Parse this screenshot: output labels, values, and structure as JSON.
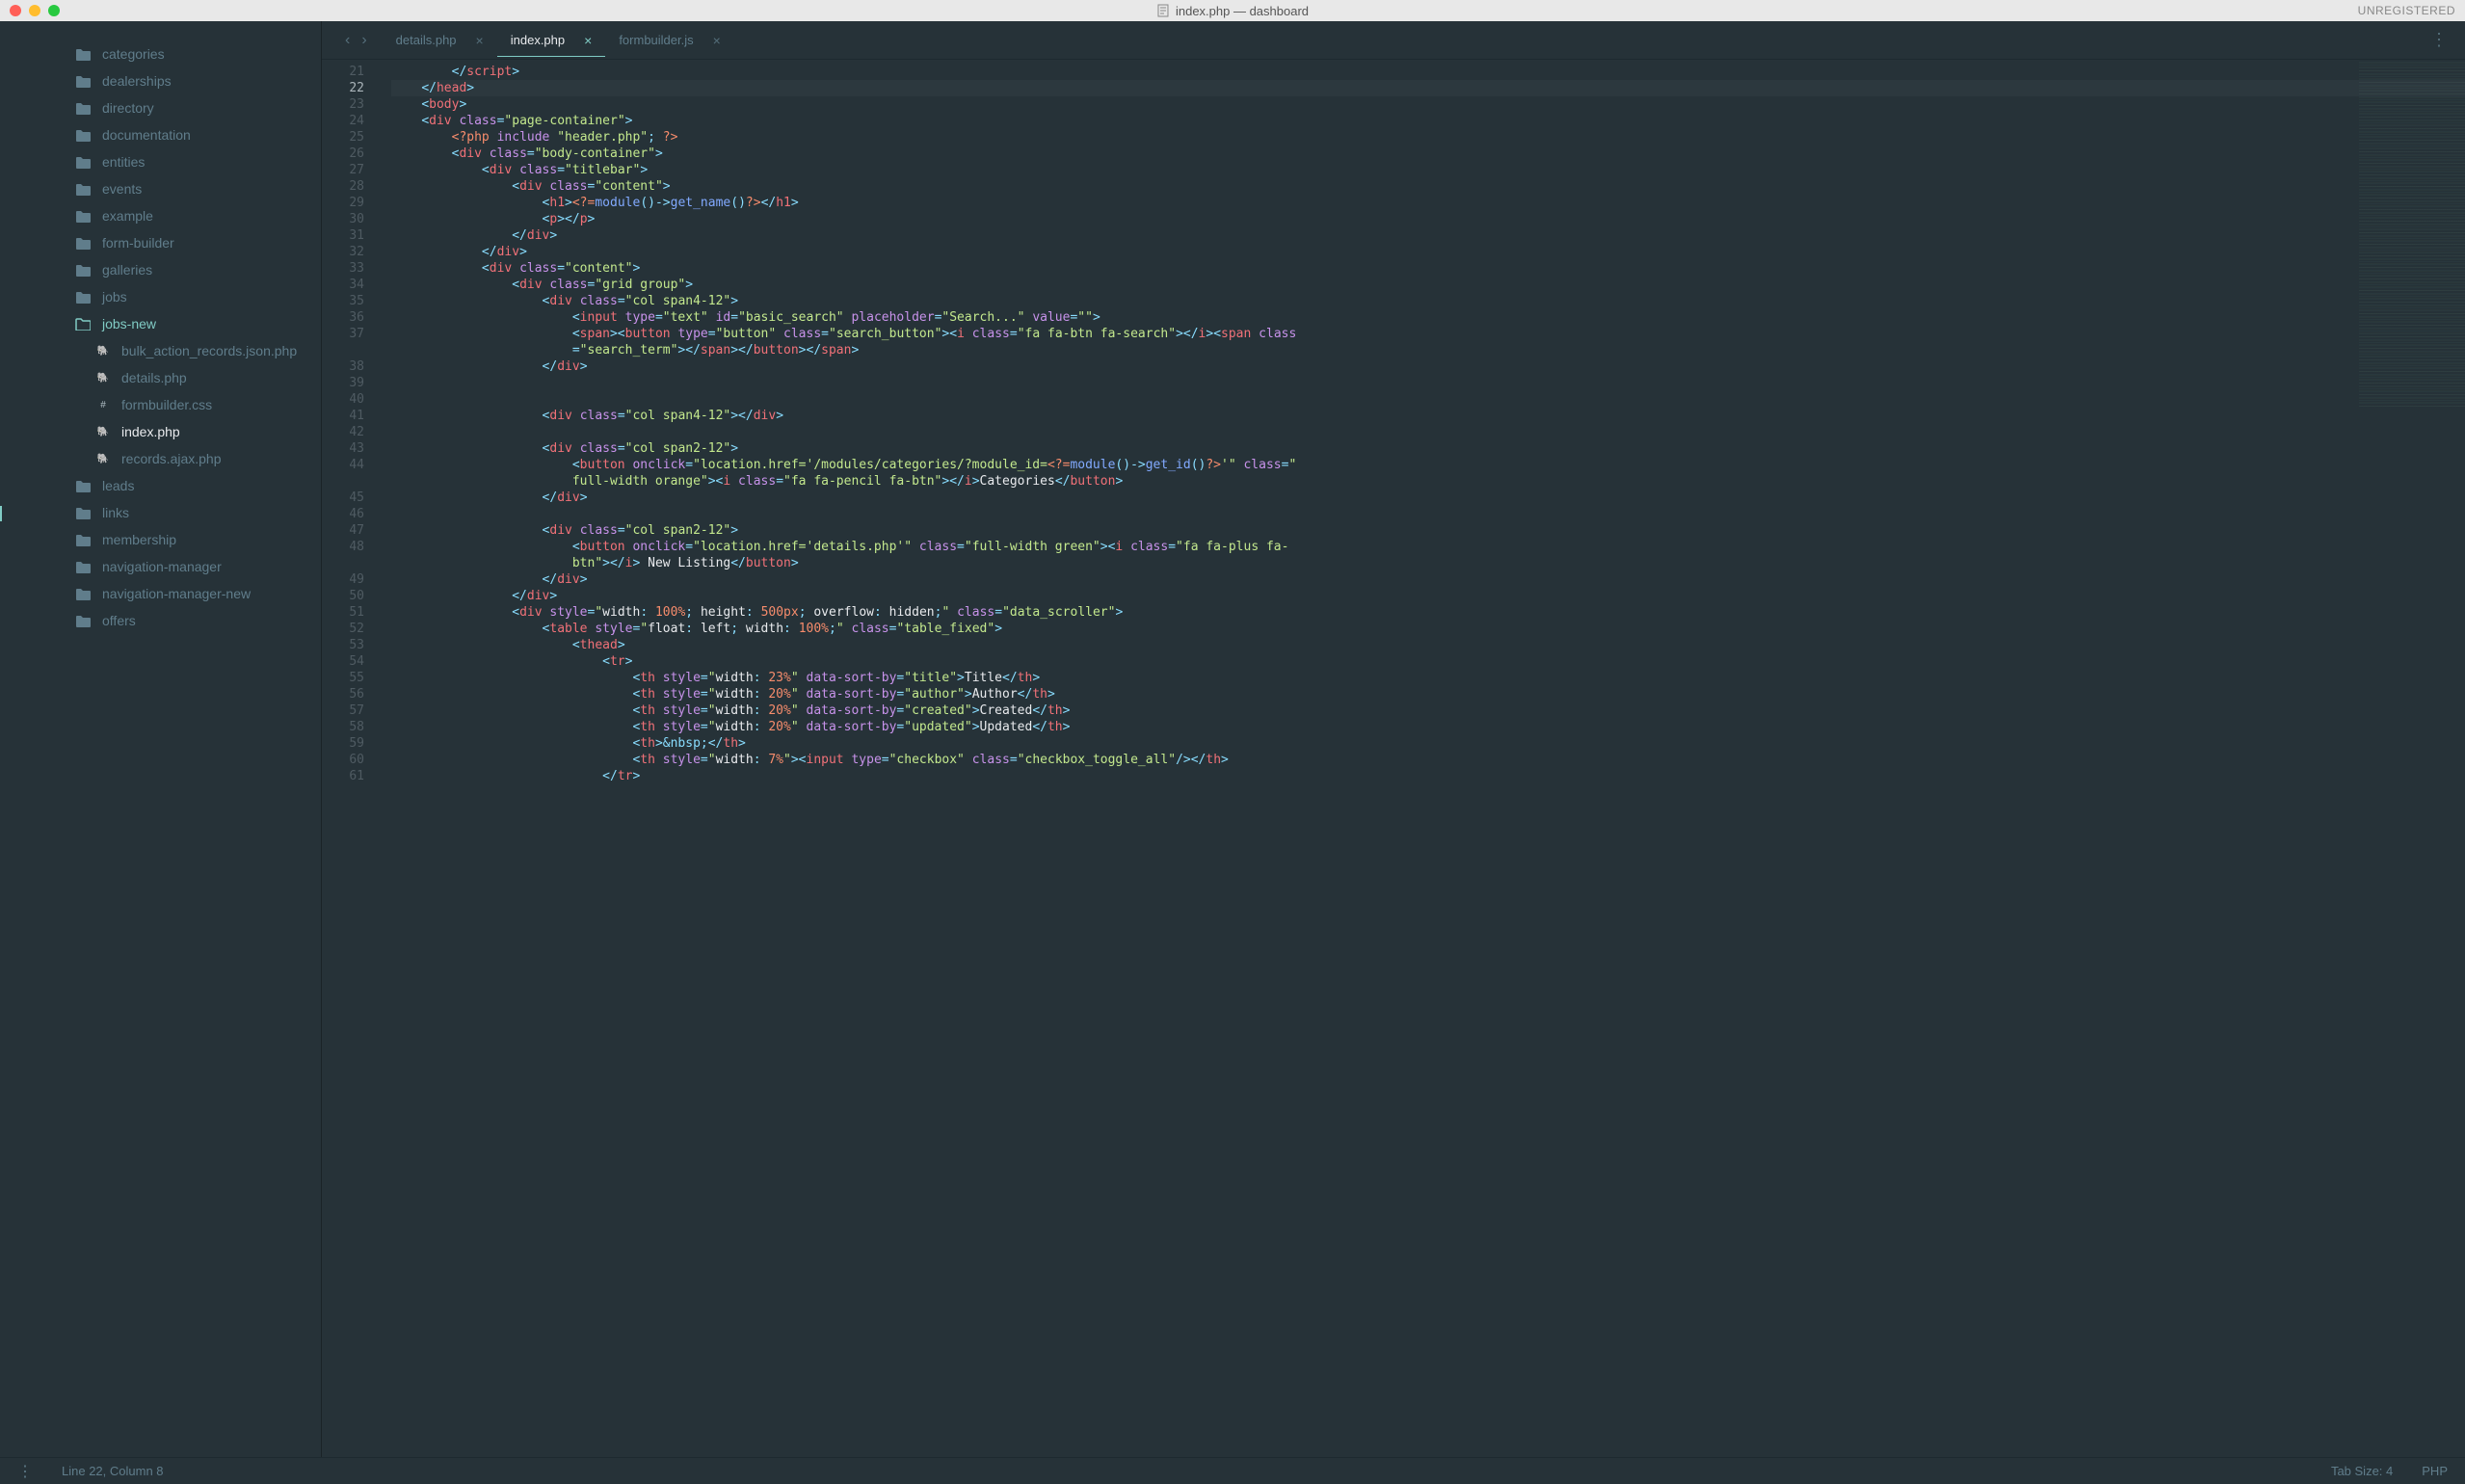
{
  "window": {
    "title": "index.php — dashboard",
    "unregistered": "UNREGISTERED"
  },
  "sidebar": {
    "items": [
      {
        "type": "folder",
        "label": "categories"
      },
      {
        "type": "folder",
        "label": "dealerships"
      },
      {
        "type": "folder",
        "label": "directory"
      },
      {
        "type": "folder",
        "label": "documentation"
      },
      {
        "type": "folder",
        "label": "entities"
      },
      {
        "type": "folder",
        "label": "events"
      },
      {
        "type": "folder",
        "label": "example"
      },
      {
        "type": "folder",
        "label": "form-builder"
      },
      {
        "type": "folder",
        "label": "galleries"
      },
      {
        "type": "folder",
        "label": "jobs"
      },
      {
        "type": "folder-open",
        "label": "jobs-new"
      },
      {
        "type": "php",
        "label": "bulk_action_records.json.php",
        "indent": true
      },
      {
        "type": "php",
        "label": "details.php",
        "indent": true
      },
      {
        "type": "css",
        "label": "formbuilder.css",
        "indent": true
      },
      {
        "type": "php",
        "label": "index.php",
        "indent": true,
        "active": true
      },
      {
        "type": "php",
        "label": "records.ajax.php",
        "indent": true
      },
      {
        "type": "folder",
        "label": "leads"
      },
      {
        "type": "folder",
        "label": "links"
      },
      {
        "type": "folder",
        "label": "membership"
      },
      {
        "type": "folder",
        "label": "navigation-manager"
      },
      {
        "type": "folder",
        "label": "navigation-manager-new"
      },
      {
        "type": "folder",
        "label": "offers"
      }
    ]
  },
  "tabs": [
    {
      "label": "details.php",
      "active": false
    },
    {
      "label": "index.php",
      "active": true
    },
    {
      "label": "formbuilder.js",
      "active": false
    }
  ],
  "gutter": {
    "start": 21,
    "end": 61,
    "highlight": 22
  },
  "code_lines": [
    {
      "n": 21,
      "html": "        <span class='t-punc'>&lt;/</span><span class='t-tag'>script</span><span class='t-punc'>&gt;</span>"
    },
    {
      "n": 22,
      "hl": true,
      "html": "    <span class='t-punc'>&lt;/</span><span class='t-tag'>head</span><span class='t-punc'>&gt;</span>"
    },
    {
      "n": 23,
      "html": "    <span class='t-punc'>&lt;</span><span class='t-tag'>body</span><span class='t-punc'>&gt;</span>"
    },
    {
      "n": 24,
      "html": "    <span class='t-punc'>&lt;</span><span class='t-tag'>div</span> <span class='t-attr'>class</span><span class='t-op'>=</span><span class='t-str'>\"page-container\"</span><span class='t-punc'>&gt;</span>"
    },
    {
      "n": 25,
      "html": "        <span class='t-php'>&lt;?php</span> <span class='t-kw'>include</span> <span class='t-str'>\"header.php\"</span><span class='t-punc'>;</span> <span class='t-php'>?&gt;</span>"
    },
    {
      "n": 26,
      "html": "        <span class='t-punc'>&lt;</span><span class='t-tag'>div</span> <span class='t-attr'>class</span><span class='t-op'>=</span><span class='t-str'>\"body-container\"</span><span class='t-punc'>&gt;</span>"
    },
    {
      "n": 27,
      "html": "            <span class='t-punc'>&lt;</span><span class='t-tag'>div</span> <span class='t-attr'>class</span><span class='t-op'>=</span><span class='t-str'>\"titlebar\"</span><span class='t-punc'>&gt;</span>"
    },
    {
      "n": 28,
      "html": "                <span class='t-punc'>&lt;</span><span class='t-tag'>div</span> <span class='t-attr'>class</span><span class='t-op'>=</span><span class='t-str'>\"content\"</span><span class='t-punc'>&gt;</span>"
    },
    {
      "n": 29,
      "html": "                    <span class='t-punc'>&lt;</span><span class='t-tag'>h1</span><span class='t-punc'>&gt;</span><span class='t-php'>&lt;?=</span><span class='t-fn'>module</span><span class='t-punc'>()</span><span class='t-op'>-&gt;</span><span class='t-fn'>get_name</span><span class='t-punc'>()</span><span class='t-php'>?&gt;</span><span class='t-punc'>&lt;/</span><span class='t-tag'>h1</span><span class='t-punc'>&gt;</span>"
    },
    {
      "n": 30,
      "html": "                    <span class='t-punc'>&lt;</span><span class='t-tag'>p</span><span class='t-punc'>&gt;&lt;/</span><span class='t-tag'>p</span><span class='t-punc'>&gt;</span>"
    },
    {
      "n": 31,
      "html": "                <span class='t-punc'>&lt;/</span><span class='t-tag'>div</span><span class='t-punc'>&gt;</span>"
    },
    {
      "n": 32,
      "html": "            <span class='t-punc'>&lt;/</span><span class='t-tag'>div</span><span class='t-punc'>&gt;</span>"
    },
    {
      "n": 33,
      "html": "            <span class='t-punc'>&lt;</span><span class='t-tag'>div</span> <span class='t-attr'>class</span><span class='t-op'>=</span><span class='t-str'>\"content\"</span><span class='t-punc'>&gt;</span>"
    },
    {
      "n": 34,
      "html": "                <span class='t-punc'>&lt;</span><span class='t-tag'>div</span> <span class='t-attr'>class</span><span class='t-op'>=</span><span class='t-str'>\"grid group\"</span><span class='t-punc'>&gt;</span>"
    },
    {
      "n": 35,
      "html": "                    <span class='t-punc'>&lt;</span><span class='t-tag'>div</span> <span class='t-attr'>class</span><span class='t-op'>=</span><span class='t-str'>\"col span4-12\"</span><span class='t-punc'>&gt;</span>"
    },
    {
      "n": 36,
      "html": "                        <span class='t-punc'>&lt;</span><span class='t-tag'>input</span> <span class='t-attr'>type</span><span class='t-op'>=</span><span class='t-str'>\"text\"</span> <span class='t-attr'>id</span><span class='t-op'>=</span><span class='t-str'>\"basic_search\"</span> <span class='t-attr'>placeholder</span><span class='t-op'>=</span><span class='t-str'>\"Search...\"</span> <span class='t-attr'>value</span><span class='t-op'>=</span><span class='t-str'>\"\"</span><span class='t-punc'>&gt;</span>"
    },
    {
      "n": 37,
      "html": "                        <span class='t-punc'>&lt;</span><span class='t-tag'>span</span><span class='t-punc'>&gt;&lt;</span><span class='t-tag'>button</span> <span class='t-attr'>type</span><span class='t-op'>=</span><span class='t-str'>\"button\"</span> <span class='t-attr'>class</span><span class='t-op'>=</span><span class='t-str'>\"search_button\"</span><span class='t-punc'>&gt;&lt;</span><span class='t-tag'>i</span> <span class='t-attr'>class</span><span class='t-op'>=</span><span class='t-str'>\"fa fa-btn fa-search\"</span><span class='t-punc'>&gt;&lt;/</span><span class='t-tag'>i</span><span class='t-punc'>&gt;&lt;</span><span class='t-tag'>span</span> <span class='t-attr'>class</span>"
    },
    {
      "n": 37.5,
      "html": "                        <span class='t-op'>=</span><span class='t-str'>\"search_term\"</span><span class='t-punc'>&gt;&lt;/</span><span class='t-tag'>span</span><span class='t-punc'>&gt;&lt;/</span><span class='t-tag'>button</span><span class='t-punc'>&gt;&lt;/</span><span class='t-tag'>span</span><span class='t-punc'>&gt;</span>"
    },
    {
      "n": 38,
      "html": "                    <span class='t-punc'>&lt;/</span><span class='t-tag'>div</span><span class='t-punc'>&gt;</span>"
    },
    {
      "n": 39,
      "html": ""
    },
    {
      "n": 40,
      "html": ""
    },
    {
      "n": 41,
      "html": "                    <span class='t-punc'>&lt;</span><span class='t-tag'>div</span> <span class='t-attr'>class</span><span class='t-op'>=</span><span class='t-str'>\"col span4-12\"</span><span class='t-punc'>&gt;&lt;/</span><span class='t-tag'>div</span><span class='t-punc'>&gt;</span>"
    },
    {
      "n": 42,
      "html": ""
    },
    {
      "n": 43,
      "html": "                    <span class='t-punc'>&lt;</span><span class='t-tag'>div</span> <span class='t-attr'>class</span><span class='t-op'>=</span><span class='t-str'>\"col span2-12\"</span><span class='t-punc'>&gt;</span>"
    },
    {
      "n": 44,
      "html": "                        <span class='t-punc'>&lt;</span><span class='t-tag'>button</span> <span class='t-attr'>onclick</span><span class='t-op'>=</span><span class='t-str'>\"location.href='/modules/categories/?module_id=</span><span class='t-php'>&lt;?=</span><span class='t-fn'>module</span><span class='t-punc'>()</span><span class='t-op'>-&gt;</span><span class='t-fn'>get_id</span><span class='t-punc'>()</span><span class='t-php'>?&gt;</span><span class='t-str'>'\"</span> <span class='t-attr'>class</span><span class='t-op'>=</span><span class='t-str'>\"</span>"
    },
    {
      "n": 44.5,
      "html": "                        <span class='t-str'>full-width orange\"</span><span class='t-punc'>&gt;&lt;</span><span class='t-tag'>i</span> <span class='t-attr'>class</span><span class='t-op'>=</span><span class='t-str'>\"fa fa-pencil fa-btn\"</span><span class='t-punc'>&gt;&lt;/</span><span class='t-tag'>i</span><span class='t-punc'>&gt;</span><span class='t-txt'>Categories</span><span class='t-punc'>&lt;/</span><span class='t-tag'>button</span><span class='t-punc'>&gt;</span>"
    },
    {
      "n": 45,
      "html": "                    <span class='t-punc'>&lt;/</span><span class='t-tag'>div</span><span class='t-punc'>&gt;</span>"
    },
    {
      "n": 46,
      "html": ""
    },
    {
      "n": 47,
      "html": "                    <span class='t-punc'>&lt;</span><span class='t-tag'>div</span> <span class='t-attr'>class</span><span class='t-op'>=</span><span class='t-str'>\"col span2-12\"</span><span class='t-punc'>&gt;</span>"
    },
    {
      "n": 48,
      "html": "                        <span class='t-punc'>&lt;</span><span class='t-tag'>button</span> <span class='t-attr'>onclick</span><span class='t-op'>=</span><span class='t-str'>\"location.href='details.php'\"</span> <span class='t-attr'>class</span><span class='t-op'>=</span><span class='t-str'>\"full-width green\"</span><span class='t-punc'>&gt;&lt;</span><span class='t-tag'>i</span> <span class='t-attr'>class</span><span class='t-op'>=</span><span class='t-str'>\"fa fa-plus fa-</span>"
    },
    {
      "n": 48.5,
      "html": "                        <span class='t-str'>btn\"</span><span class='t-punc'>&gt;&lt;/</span><span class='t-tag'>i</span><span class='t-punc'>&gt;</span><span class='t-txt'> New Listing</span><span class='t-punc'>&lt;/</span><span class='t-tag'>button</span><span class='t-punc'>&gt;</span>"
    },
    {
      "n": 49,
      "html": "                    <span class='t-punc'>&lt;/</span><span class='t-tag'>div</span><span class='t-punc'>&gt;</span>"
    },
    {
      "n": 50,
      "html": "                <span class='t-punc'>&lt;/</span><span class='t-tag'>div</span><span class='t-punc'>&gt;</span>"
    },
    {
      "n": 51,
      "html": "                <span class='t-punc'>&lt;</span><span class='t-tag'>div</span> <span class='t-attr'>style</span><span class='t-op'>=</span><span class='t-str'>\"</span><span class='t-txt'>width</span><span class='t-punc'>:</span> <span class='t-num'>100%</span><span class='t-punc'>;</span> <span class='t-txt'>height</span><span class='t-punc'>:</span> <span class='t-num'>500px</span><span class='t-punc'>;</span> <span class='t-txt'>overflow</span><span class='t-punc'>:</span> <span class='t-txt'>hidden</span><span class='t-punc'>;</span><span class='t-str'>\"</span> <span class='t-attr'>class</span><span class='t-op'>=</span><span class='t-str'>\"data_scroller\"</span><span class='t-punc'>&gt;</span>"
    },
    {
      "n": 52,
      "html": "                    <span class='t-punc'>&lt;</span><span class='t-tag'>table</span> <span class='t-attr'>style</span><span class='t-op'>=</span><span class='t-str'>\"</span><span class='t-txt'>float</span><span class='t-punc'>:</span> <span class='t-txt'>left</span><span class='t-punc'>;</span> <span class='t-txt'>width</span><span class='t-punc'>:</span> <span class='t-num'>100%</span><span class='t-punc'>;</span><span class='t-str'>\"</span> <span class='t-attr'>class</span><span class='t-op'>=</span><span class='t-str'>\"table_fixed\"</span><span class='t-punc'>&gt;</span>"
    },
    {
      "n": 53,
      "html": "                        <span class='t-punc'>&lt;</span><span class='t-tag'>thead</span><span class='t-punc'>&gt;</span>"
    },
    {
      "n": 54,
      "html": "                            <span class='t-punc'>&lt;</span><span class='t-tag'>tr</span><span class='t-punc'>&gt;</span>"
    },
    {
      "n": 55,
      "html": "                                <span class='t-punc'>&lt;</span><span class='t-tag'>th</span> <span class='t-attr'>style</span><span class='t-op'>=</span><span class='t-str'>\"</span><span class='t-txt'>width</span><span class='t-punc'>:</span> <span class='t-num'>23%</span><span class='t-str'>\"</span> <span class='t-attr'>data-sort-by</span><span class='t-op'>=</span><span class='t-str'>\"title\"</span><span class='t-punc'>&gt;</span><span class='t-txt'>Title</span><span class='t-punc'>&lt;/</span><span class='t-tag'>th</span><span class='t-punc'>&gt;</span>"
    },
    {
      "n": 56,
      "html": "                                <span class='t-punc'>&lt;</span><span class='t-tag'>th</span> <span class='t-attr'>style</span><span class='t-op'>=</span><span class='t-str'>\"</span><span class='t-txt'>width</span><span class='t-punc'>:</span> <span class='t-num'>20%</span><span class='t-str'>\"</span> <span class='t-attr'>data-sort-by</span><span class='t-op'>=</span><span class='t-str'>\"author\"</span><span class='t-punc'>&gt;</span><span class='t-txt'>Author</span><span class='t-punc'>&lt;/</span><span class='t-tag'>th</span><span class='t-punc'>&gt;</span>"
    },
    {
      "n": 57,
      "html": "                                <span class='t-punc'>&lt;</span><span class='t-tag'>th</span> <span class='t-attr'>style</span><span class='t-op'>=</span><span class='t-str'>\"</span><span class='t-txt'>width</span><span class='t-punc'>:</span> <span class='t-num'>20%</span><span class='t-str'>\"</span> <span class='t-attr'>data-sort-by</span><span class='t-op'>=</span><span class='t-str'>\"created\"</span><span class='t-punc'>&gt;</span><span class='t-txt'>Created</span><span class='t-punc'>&lt;/</span><span class='t-tag'>th</span><span class='t-punc'>&gt;</span>"
    },
    {
      "n": 58,
      "html": "                                <span class='t-punc'>&lt;</span><span class='t-tag'>th</span> <span class='t-attr'>style</span><span class='t-op'>=</span><span class='t-str'>\"</span><span class='t-txt'>width</span><span class='t-punc'>:</span> <span class='t-num'>20%</span><span class='t-str'>\"</span> <span class='t-attr'>data-sort-by</span><span class='t-op'>=</span><span class='t-str'>\"updated\"</span><span class='t-punc'>&gt;</span><span class='t-txt'>Updated</span><span class='t-punc'>&lt;/</span><span class='t-tag'>th</span><span class='t-punc'>&gt;</span>"
    },
    {
      "n": 59,
      "html": "                                <span class='t-punc'>&lt;</span><span class='t-tag'>th</span><span class='t-punc'>&gt;</span><span class='t-ent'>&amp;nbsp;</span><span class='t-punc'>&lt;/</span><span class='t-tag'>th</span><span class='t-punc'>&gt;</span>"
    },
    {
      "n": 60,
      "html": "                                <span class='t-punc'>&lt;</span><span class='t-tag'>th</span> <span class='t-attr'>style</span><span class='t-op'>=</span><span class='t-str'>\"</span><span class='t-txt'>width</span><span class='t-punc'>:</span> <span class='t-num'>7%</span><span class='t-str'>\"</span><span class='t-punc'>&gt;&lt;</span><span class='t-tag'>input</span> <span class='t-attr'>type</span><span class='t-op'>=</span><span class='t-str'>\"checkbox\"</span> <span class='t-attr'>class</span><span class='t-op'>=</span><span class='t-str'>\"checkbox_toggle_all\"</span><span class='t-punc'>/&gt;&lt;/</span><span class='t-tag'>th</span><span class='t-punc'>&gt;</span>"
    },
    {
      "n": 61,
      "html": "                            <span class='t-punc'>&lt;/</span><span class='t-tag'>tr</span><span class='t-punc'>&gt;</span>"
    }
  ],
  "statusbar": {
    "position": "Line 22, Column 8",
    "tab_size": "Tab Size: 4",
    "syntax": "PHP"
  }
}
